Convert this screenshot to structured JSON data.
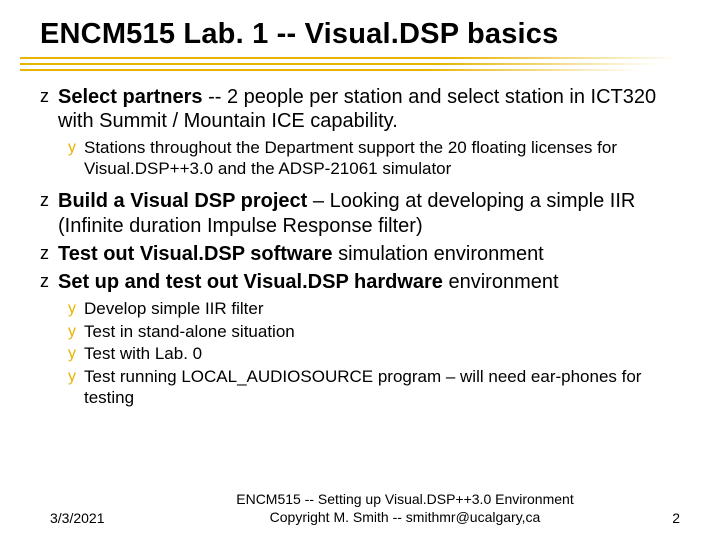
{
  "title": "ENCM515 Lab. 1 -- Visual.DSP basics",
  "bullets": [
    {
      "lead": "Select partners",
      "rest": " -- 2 people per station and select station in ICT320 with Summit / Mountain ICE capability.",
      "subs": [
        "Stations throughout the Department support the 20 floating licenses for Visual.DSP++3.0 and the ADSP-21061 simulator"
      ]
    },
    {
      "lead": "Build a Visual DSP project",
      "rest": " – Looking at developing a simple IIR (Infinite duration Impulse Response filter)",
      "subs": []
    },
    {
      "lead": "Test out Visual.DSP software",
      "rest": " simulation environment",
      "subs": []
    },
    {
      "lead": "Set up and test out Visual.DSP hardware",
      "rest": " environment",
      "subs": [
        "Develop simple IIR filter",
        "Test in stand-alone situation",
        "Test with Lab. 0",
        "Test running LOCAL_AUDIOSOURCE program – will need ear-phones for testing"
      ]
    }
  ],
  "footer": {
    "date": "3/3/2021",
    "line1": "ENCM515 -- Setting up Visual.DSP++3.0 Environment",
    "line2": "Copyright M. Smith -- smithmr@ucalgary,ca",
    "page": "2"
  },
  "glyphs": {
    "z": "z",
    "y": "y"
  }
}
